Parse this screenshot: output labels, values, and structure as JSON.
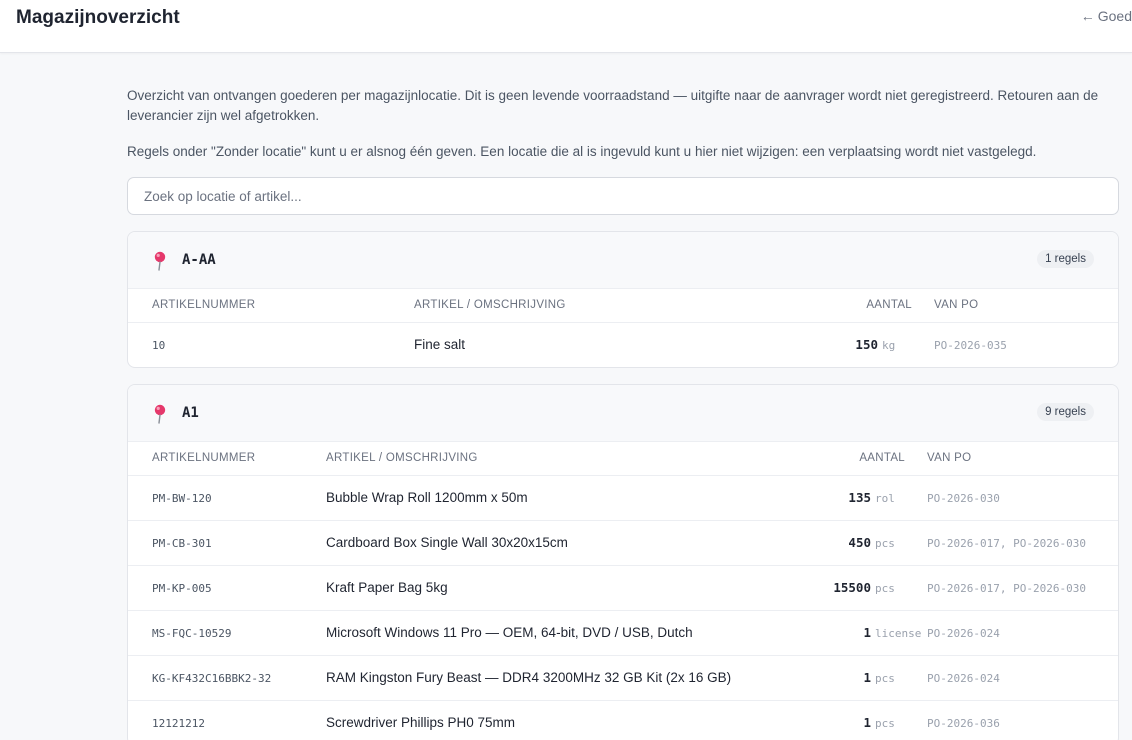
{
  "header": {
    "title": "Magazijnoverzicht",
    "back_arrow": "←",
    "back_label": "Goed"
  },
  "intro": {
    "p1": "Overzicht van ontvangen goederen per magazijnlocatie. Dit is geen levende voorraadstand — uitgifte naar de aanvrager wordt niet geregistreerd. Retouren aan de leverancier zijn wel afgetrokken.",
    "p2": "Regels onder \"Zonder locatie\" kunt u er alsnog één geven. Een locatie die al is ingevuld kunt u hier niet wijzigen: een verplaatsing wordt niet vastgelegd."
  },
  "search": {
    "placeholder": "Zoek op locatie of artikel..."
  },
  "columns": {
    "sku": "Artikelnummer",
    "item": "Artikel / omschrijving",
    "qty": "Aantal",
    "po": "Van PO"
  },
  "icons": {
    "location": "pushpin-icon",
    "back": "arrow-left-icon"
  },
  "colors": {
    "pin": "#e5386b",
    "accent_text": "#1f2430",
    "muted": "#9aa1ad"
  },
  "locations": [
    {
      "name": "A-AA",
      "count_label": "1 regels",
      "rows": [
        {
          "sku": "10",
          "item": "Fine salt",
          "qty": "150",
          "unit": "kg",
          "po": "PO-2026-035"
        }
      ]
    },
    {
      "name": "A1",
      "count_label": "9 regels",
      "rows": [
        {
          "sku": "PM-BW-120",
          "item": "Bubble Wrap Roll 1200mm x 50m",
          "qty": "135",
          "unit": "rol",
          "po": "PO-2026-030"
        },
        {
          "sku": "PM-CB-301",
          "item": "Cardboard Box Single Wall 30x20x15cm",
          "qty": "450",
          "unit": "pcs",
          "po": "PO-2026-017, PO-2026-030"
        },
        {
          "sku": "PM-KP-005",
          "item": "Kraft Paper Bag 5kg",
          "qty": "15500",
          "unit": "pcs",
          "po": "PO-2026-017, PO-2026-030"
        },
        {
          "sku": "MS-FQC-10529",
          "item": "Microsoft Windows 11 Pro — OEM, 64-bit, DVD / USB, Dutch",
          "qty": "1",
          "unit": "license",
          "po": "PO-2026-024"
        },
        {
          "sku": "KG-KF432C16BBK2-32",
          "item": "RAM Kingston Fury Beast — DDR4 3200MHz 32 GB Kit (2x 16 GB)",
          "qty": "1",
          "unit": "pcs",
          "po": "PO-2026-024"
        },
        {
          "sku": "12121212",
          "item": "Screwdriver Phillips PH0 75mm",
          "qty": "1",
          "unit": "pcs",
          "po": "PO-2026-036"
        }
      ]
    }
  ]
}
